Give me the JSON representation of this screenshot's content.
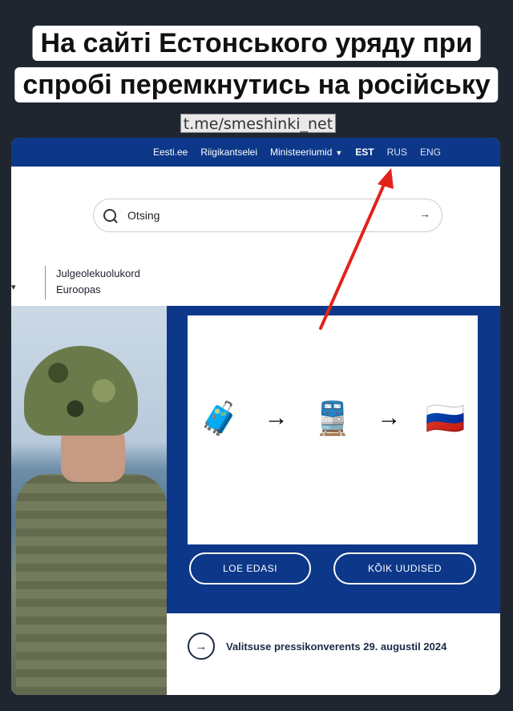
{
  "caption": {
    "line1": "На сайті Естонського уряду при",
    "line2": "спробі перемкнутись на російську"
  },
  "watermark": "t.me/smeshinki_net",
  "site": {
    "topnav": {
      "links": [
        "Eesti.ee",
        "Riigikantselei",
        "Ministeeriumid"
      ],
      "languages": [
        "EST",
        "RUS",
        "ENG"
      ],
      "active_language": "EST"
    },
    "search": {
      "placeholder": "Otsing",
      "icon": "search-icon",
      "submit_icon": "arrow-right-icon"
    },
    "breadcrumb": {
      "line1": "Julgeolekuolukord",
      "line2": "Euroopas"
    },
    "hero": {
      "emoji_sequence": [
        "🧳",
        "→",
        "🚆",
        "→",
        "🇷🇺"
      ]
    },
    "buttons": {
      "read_more": "LOE EDASI",
      "all_news": "KÕIK UUDISED"
    },
    "news_item": {
      "title": "Valitsuse pressikonverents 29. augustil 2024"
    }
  },
  "colors": {
    "brand_blue": "#0d3889",
    "annotation_red": "#e2231a"
  }
}
